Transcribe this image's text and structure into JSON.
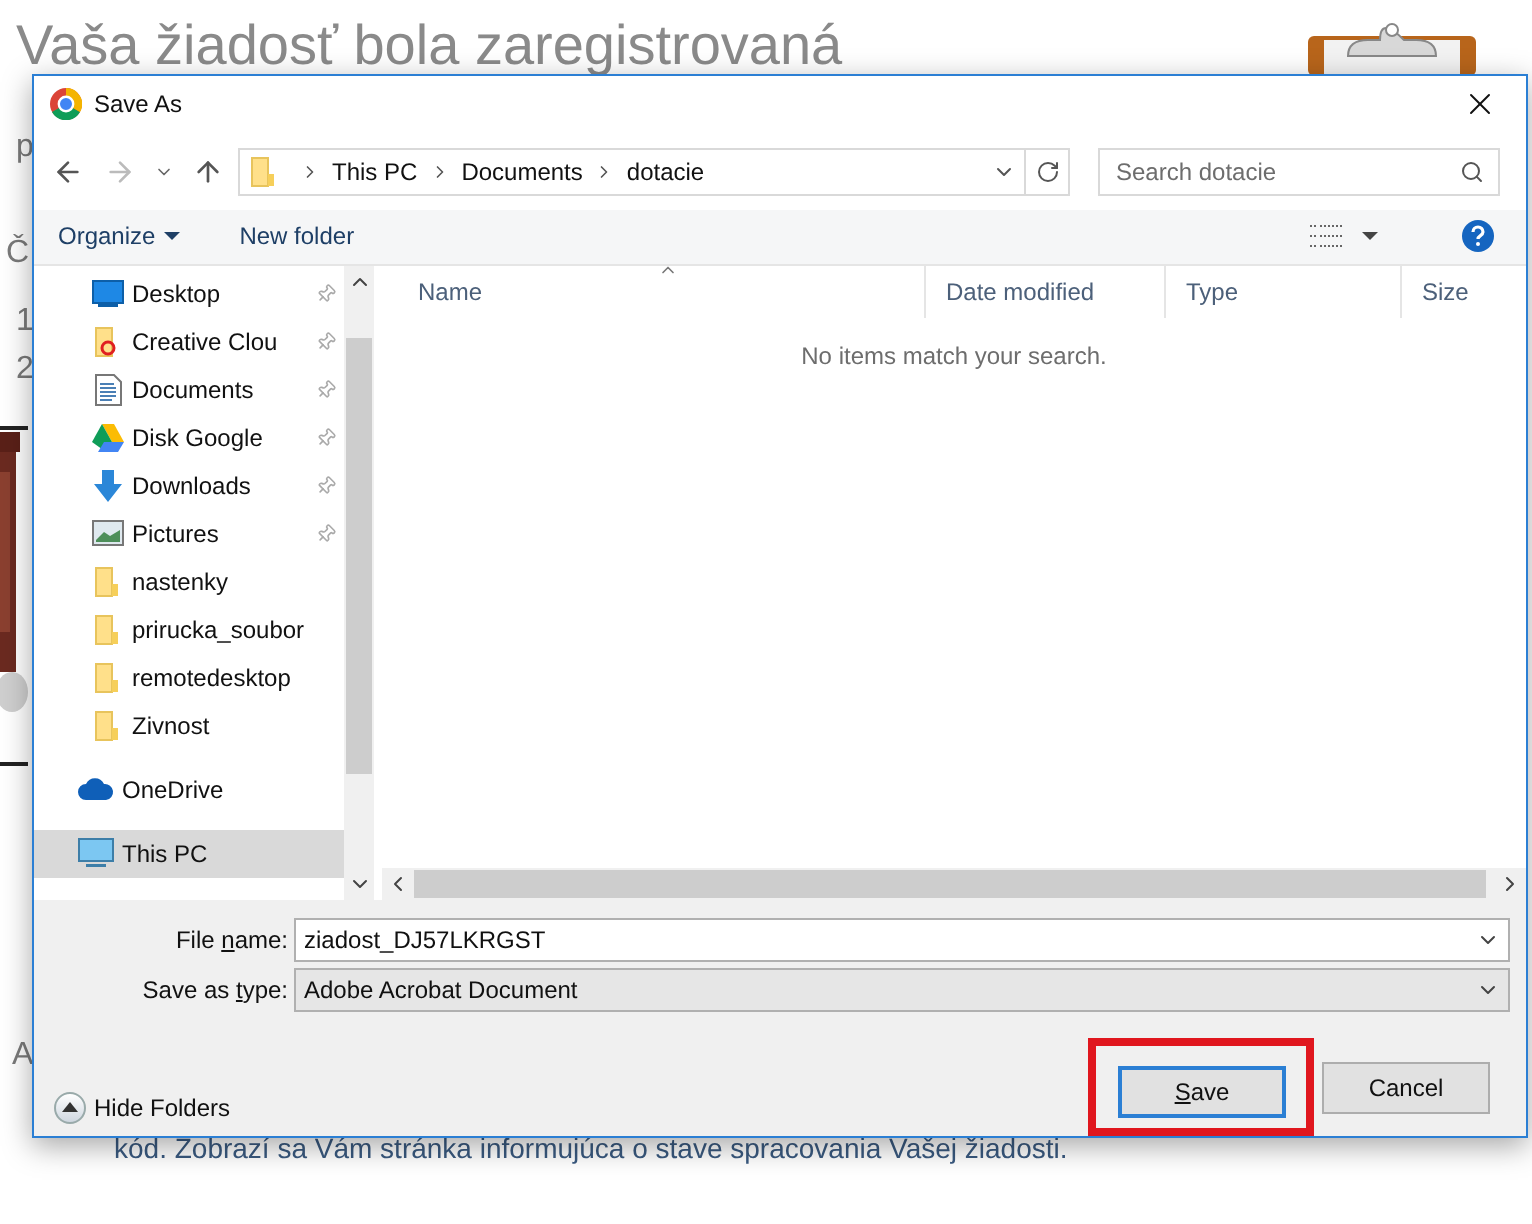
{
  "page": {
    "title": "Vaša žiadosť bola zaregistrovaná",
    "fragments": [
      {
        "text": "p"
      },
      {
        "text": "Č"
      },
      {
        "text": "1"
      },
      {
        "text": "2"
      },
      {
        "text": "A"
      }
    ],
    "footer_text": "kód. Zobrazí sa Vám stránka informujúca o stave spracovania Vašej žiadosti."
  },
  "dialog": {
    "title": "Save As",
    "breadcrumbs": [
      "This PC",
      "Documents",
      "dotacie"
    ],
    "search": {
      "placeholder": "Search dotacie"
    },
    "toolbar": {
      "organize": "Organize",
      "new_folder": "New folder"
    },
    "nav": {
      "quick_access": [
        {
          "label": "Desktop",
          "kind": "desktop",
          "pinned": true,
          "selected": false
        },
        {
          "label": "Creative Clou",
          "kind": "cloud-folder",
          "pinned": true,
          "selected": false
        },
        {
          "label": "Documents",
          "kind": "documents",
          "pinned": true,
          "selected": false
        },
        {
          "label": "Disk Google",
          "kind": "drive",
          "pinned": true,
          "selected": false
        },
        {
          "label": "Downloads",
          "kind": "downloads",
          "pinned": true,
          "selected": false
        },
        {
          "label": "Pictures",
          "kind": "pictures",
          "pinned": true,
          "selected": false
        },
        {
          "label": "nastenky",
          "kind": "folder",
          "pinned": false,
          "selected": false
        },
        {
          "label": "prirucka_soubor",
          "kind": "folder",
          "pinned": false,
          "selected": false
        },
        {
          "label": "remotedesktop",
          "kind": "folder",
          "pinned": false,
          "selected": false
        },
        {
          "label": "Zivnost",
          "kind": "folder",
          "pinned": false,
          "selected": false
        }
      ],
      "locations": [
        {
          "label": "OneDrive",
          "kind": "onedrive",
          "selected": false
        },
        {
          "label": "This PC",
          "kind": "pc",
          "selected": true
        }
      ]
    },
    "columns": [
      "Name",
      "Date modified",
      "Type",
      "Size"
    ],
    "empty_message": "No items match your search.",
    "file_name": {
      "label": {
        "before": "File ",
        "key": "n",
        "after": "ame:"
      },
      "value": "ziadost_DJ57LKRGST"
    },
    "save_type": {
      "label": {
        "before": "Save as ",
        "key": "t",
        "after": "ype:"
      },
      "value": "Adobe Acrobat Document"
    },
    "hide_folders": "Hide Folders",
    "buttons": [
      {
        "label": {
          "key": "S",
          "after": "ave"
        },
        "kind": "primary",
        "highlighted": true
      },
      {
        "label": {
          "before": "Cancel"
        },
        "kind": "secondary",
        "highlighted": false
      }
    ]
  }
}
